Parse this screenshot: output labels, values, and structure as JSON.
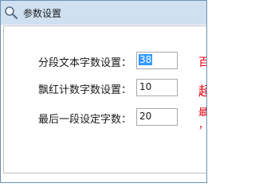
{
  "window": {
    "title": "参数设置",
    "icon": "magnifier-icon"
  },
  "settings": [
    {
      "label": "分段文本字数设置：",
      "value": "38",
      "selected": true
    },
    {
      "label": "飘红计数字数设置：",
      "value": "10",
      "selected": false
    },
    {
      "label": "最后一段设定字数：",
      "value": "20",
      "selected": false
    }
  ],
  "notes": {
    "note_1": "百",
    "note_2": "超",
    "note_3": "最",
    "note_3_line2": "，"
  },
  "colors": {
    "titlebar": "#cfe0f1",
    "note_red": "#e60012",
    "selection": "#3399ff"
  }
}
